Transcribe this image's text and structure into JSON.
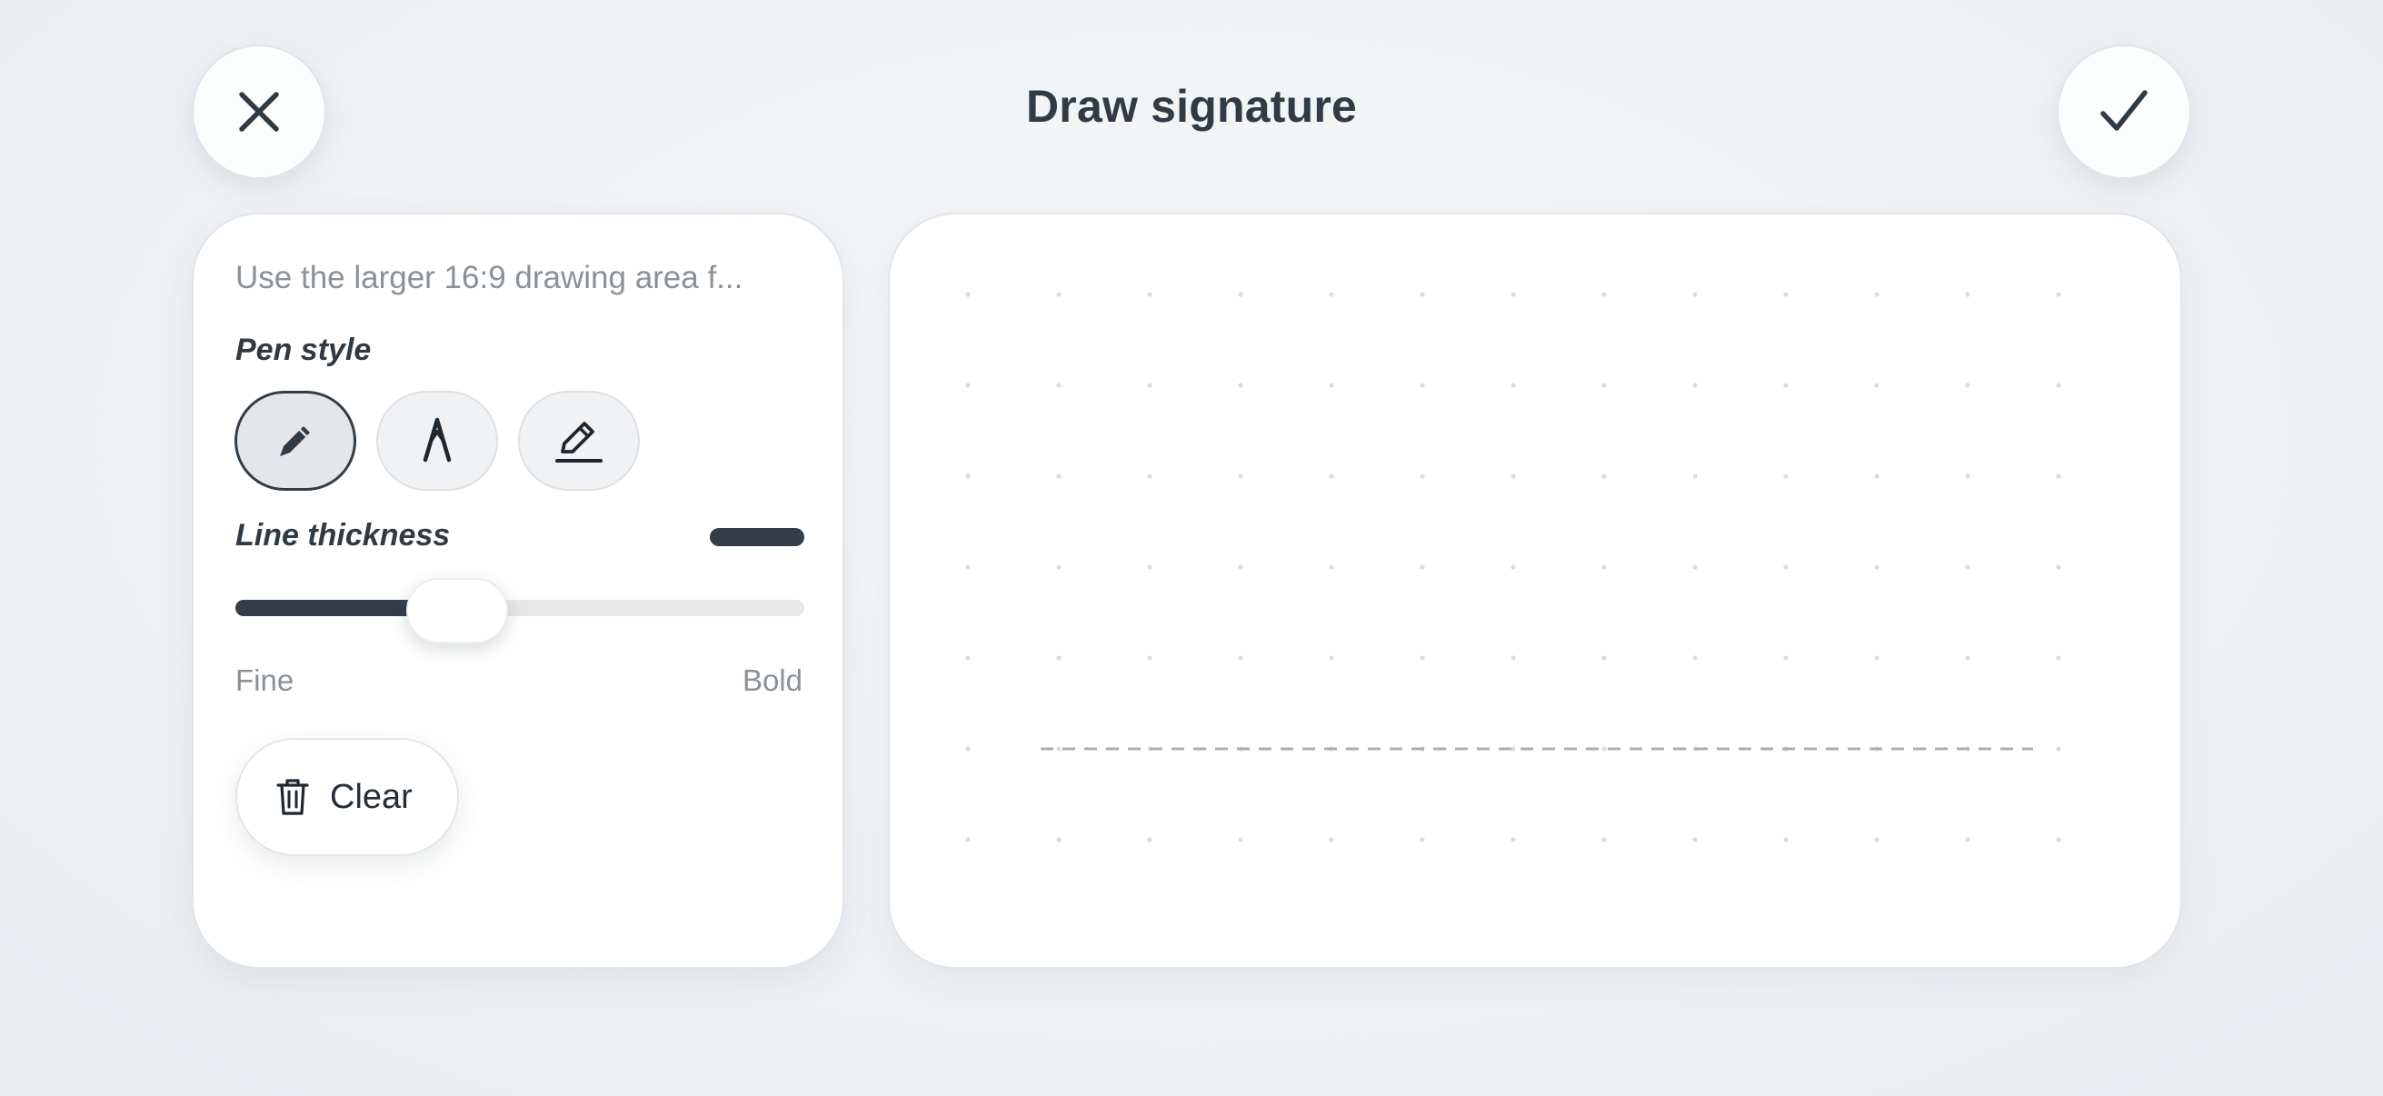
{
  "header": {
    "title": "Draw signature",
    "close_icon": "close-icon",
    "confirm_icon": "checkmark-icon"
  },
  "panel": {
    "hint": "Use the larger 16:9 drawing area f...",
    "pen_style_label": "Pen style",
    "pen_styles": [
      {
        "id": "pencil",
        "icon": "pencil-icon",
        "selected": true
      },
      {
        "id": "nib",
        "icon": "fountain-pen-nib-icon",
        "selected": false
      },
      {
        "id": "marker",
        "icon": "marker-pen-icon",
        "selected": false
      }
    ],
    "thickness_label": "Line thickness",
    "thickness_value_fraction": 0.39,
    "scale_min_label": "Fine",
    "scale_max_label": "Bold",
    "clear_label": "Clear",
    "clear_icon": "trash-icon"
  },
  "canvas": {
    "grid": "dotted",
    "baseline": "dashed"
  },
  "colors": {
    "ink": "#333e48",
    "background": "#eef1f4",
    "surface": "#ffffff",
    "muted_text": "#8a9198"
  }
}
